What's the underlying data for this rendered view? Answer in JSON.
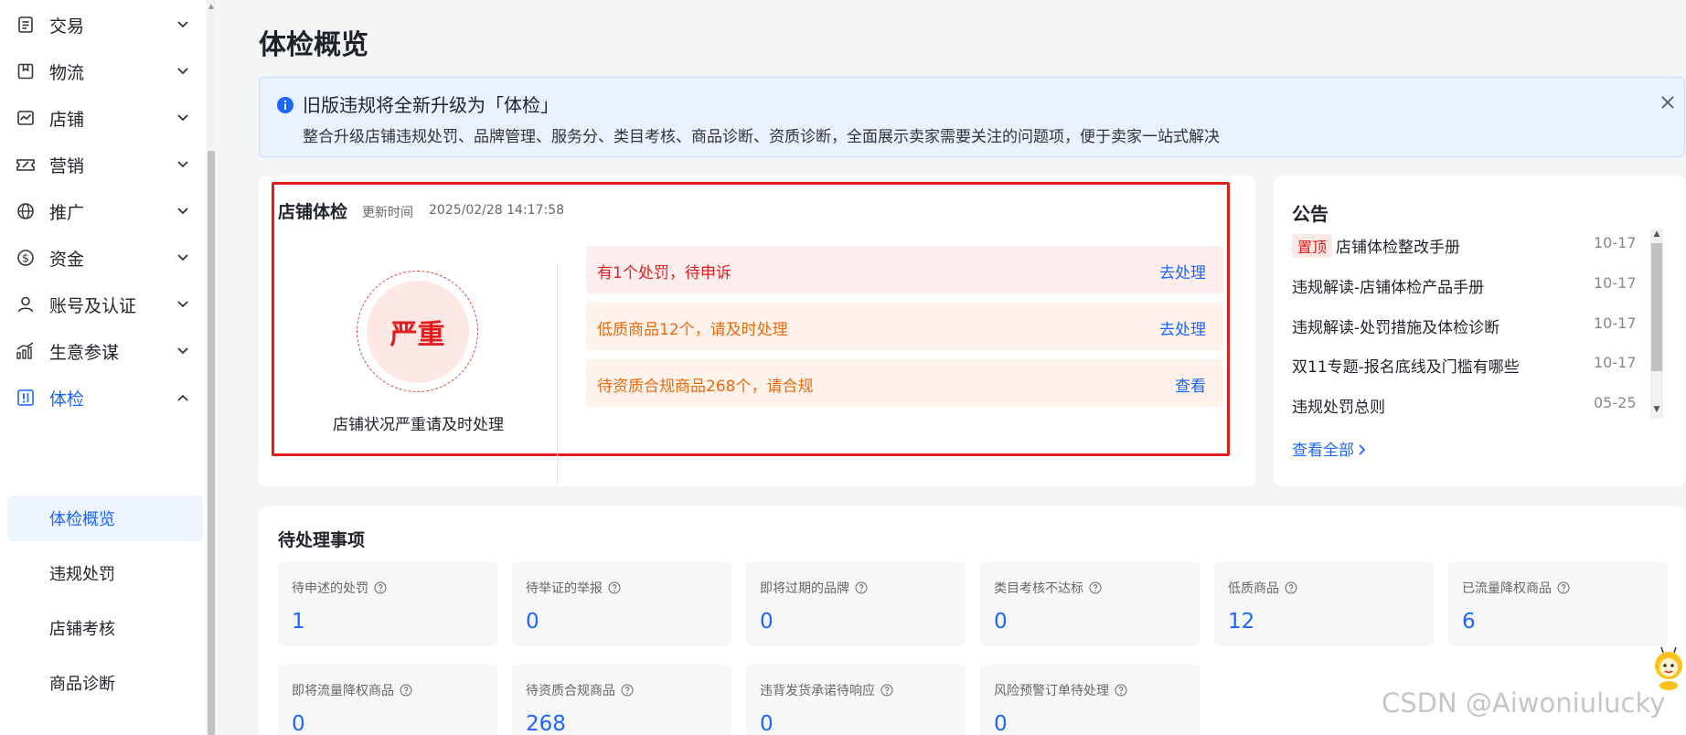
{
  "sidebar": {
    "items": [
      {
        "label": "交易",
        "icon": "clipboard-icon",
        "expanded": false
      },
      {
        "label": "物流",
        "icon": "package-icon",
        "expanded": false
      },
      {
        "label": "店铺",
        "icon": "store-chart-icon",
        "expanded": false
      },
      {
        "label": "营销",
        "icon": "ticket-icon",
        "expanded": false
      },
      {
        "label": "推广",
        "icon": "globe-ad-icon",
        "expanded": false
      },
      {
        "label": "资金",
        "icon": "dollar-circle-icon",
        "expanded": false
      },
      {
        "label": "账号及认证",
        "icon": "user-icon",
        "expanded": false
      },
      {
        "label": "生意参谋",
        "icon": "growth-chart-icon",
        "expanded": false
      },
      {
        "label": "体检",
        "icon": "health-check-icon",
        "expanded": true
      }
    ],
    "subitems": [
      "体检概览",
      "违规处罚",
      "店铺考核",
      "商品诊断"
    ],
    "selected_subitem": "体检概览"
  },
  "page": {
    "title": "体检概览"
  },
  "notice": {
    "title": "旧版违规将全新升级为「体检」",
    "description": "整合升级店铺违规处罚、品牌管理、服务分、类目考核、商品诊断、资质诊断，全面展示卖家需要关注的问题项，便于卖家一站式解决"
  },
  "health": {
    "title": "店铺体检",
    "update_label": "更新时间",
    "update_time": "2025/02/28 14:17:58",
    "status": "严重",
    "status_desc": "店铺状况严重请及时处理",
    "issues": [
      {
        "text": "有1个处罚，待申诉",
        "action": "去处理",
        "color": "#e01e1e",
        "bg": "#fdeeed"
      },
      {
        "text": "低质商品12个，请及时处理",
        "action": "去处理",
        "color": "#ea6a10",
        "bg": "#fef2ea"
      },
      {
        "text": "待资质合规商品268个，请合规",
        "action": "查看",
        "color": "#ea6a10",
        "bg": "#fef2ea"
      }
    ]
  },
  "announcements": {
    "title": "公告",
    "pin_label": "置顶",
    "items": [
      {
        "text": "店铺体检整改手册",
        "date": "10-17",
        "pinned": true
      },
      {
        "text": "违规解读-店铺体检产品手册",
        "date": "10-17"
      },
      {
        "text": "违规解读-处罚措施及体检诊断",
        "date": "10-17"
      },
      {
        "text": "双11专题-报名底线及门槛有哪些",
        "date": "10-17"
      },
      {
        "text": "违规处罚总则",
        "date": "05-25"
      }
    ],
    "view_all": "查看全部"
  },
  "pending": {
    "title": "待处理事项",
    "stats": [
      {
        "label": "待申述的处罚",
        "value": "1"
      },
      {
        "label": "待举证的举报",
        "value": "0"
      },
      {
        "label": "即将过期的品牌",
        "value": "0"
      },
      {
        "label": "类目考核不达标",
        "value": "0"
      },
      {
        "label": "低质商品",
        "value": "12"
      },
      {
        "label": "已流量降权商品",
        "value": "6"
      },
      {
        "label": "即将流量降权商品",
        "value": "0"
      },
      {
        "label": "待资质合规商品",
        "value": "268"
      },
      {
        "label": "违背发货承诺待响应",
        "value": "0"
      },
      {
        "label": "风险预警订单待处理",
        "value": "0"
      }
    ]
  },
  "watermark": "CSDN @Aiwoniulucky",
  "colors": {
    "accent": "#1a66ff",
    "danger": "#e01e1e",
    "warning": "#ea6a10"
  }
}
